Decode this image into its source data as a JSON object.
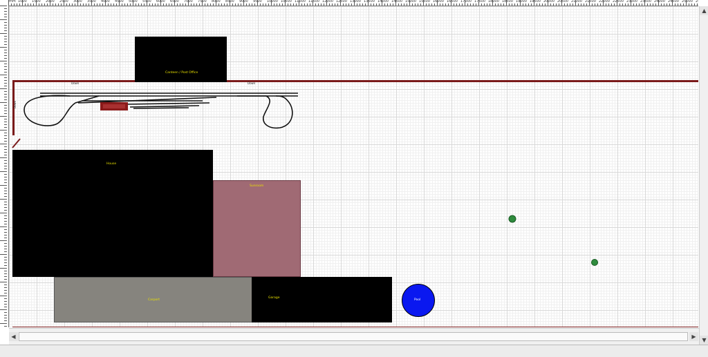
{
  "ruler": {
    "unit_label": "mm",
    "top_labels": [
      "1000",
      "1500",
      "2000",
      "2500",
      "3000",
      "3500",
      "4000",
      "4500",
      "5000",
      "5500",
      "6000",
      "6500",
      "7000",
      "7500",
      "8000",
      "8500",
      "9000",
      "9500",
      "10000",
      "10500",
      "11000",
      "11500",
      "12000",
      "12500",
      "13000",
      "13500",
      "14000",
      "14500",
      "15000",
      "15500",
      "16000",
      "16500",
      "17000",
      "17500",
      "18000",
      "18500",
      "19000",
      "19500",
      "20000",
      "20500",
      "21000",
      "21500",
      "22000",
      "22500",
      "23000",
      "23500",
      "24000",
      "24500",
      "25000",
      "25500"
    ]
  },
  "layout": {
    "blocks": {
      "post_office": {
        "label": "Canteen / Post Office",
        "fill": "#000000",
        "label_color": "#e8e000"
      },
      "house": {
        "label": "House",
        "fill": "#000000",
        "label_color": "#e8e000"
      },
      "sunroom": {
        "label": "Sunroom",
        "fill": "#a06a74",
        "label_color": "#e8e000"
      },
      "carport": {
        "label": "Carport",
        "fill": "#86847e",
        "label_color": "#e8e000"
      },
      "garage": {
        "label": "Garage",
        "fill": "#000000",
        "label_color": "#e8e000"
      },
      "pool": {
        "label": "Pool",
        "fill": "#0a18f0",
        "label_color": "#ffffff"
      }
    },
    "track_labels": {
      "left_top": "Down",
      "right_top": "Down",
      "left_side": "Down"
    },
    "boundary_color": "#7a1a1a",
    "tree_color": "#2e8b3d",
    "station_color": "#8b1a1a"
  },
  "scrollbars": {
    "up_arrow": "▲",
    "down_arrow": "▼",
    "left_arrow": "◀",
    "right_arrow": "▶"
  }
}
